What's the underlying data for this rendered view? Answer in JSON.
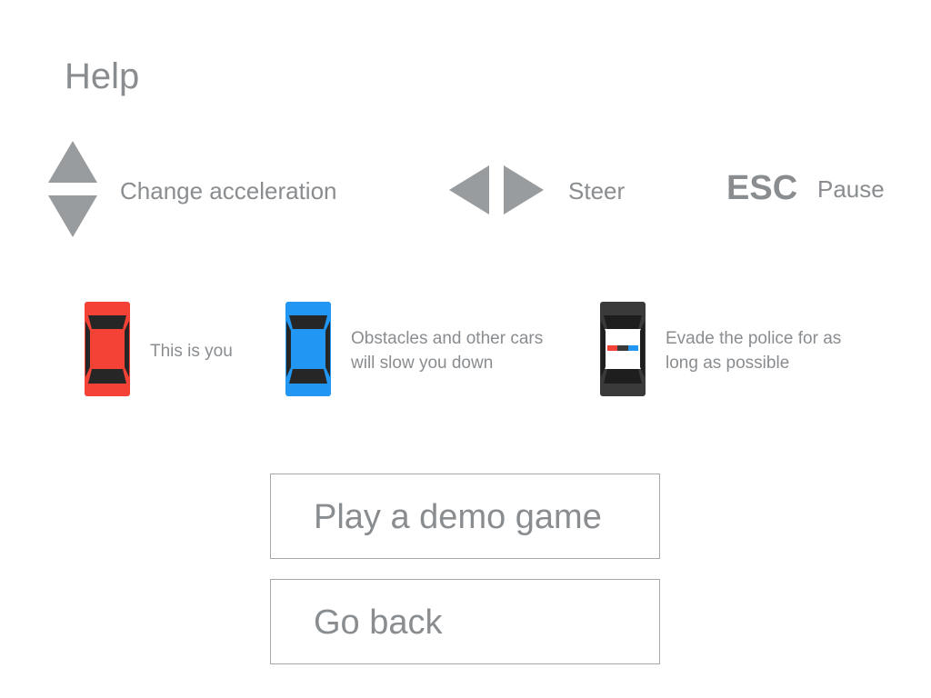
{
  "title": "Help",
  "controls": {
    "accel": {
      "icon": "up-down-arrows-icon",
      "label": "Change acceleration"
    },
    "steer": {
      "icon": "left-right-arrows-icon",
      "label": "Steer"
    },
    "pause": {
      "key": "ESC",
      "label": "Pause"
    }
  },
  "cars": {
    "player": {
      "icon": "red-car-icon",
      "color": "#f44336",
      "text": "This is you"
    },
    "obstacle": {
      "icon": "blue-car-icon",
      "color": "#2196f3",
      "line1": "Obstacles and other cars",
      "line2": "will slow you down"
    },
    "police": {
      "icon": "police-car-icon",
      "color": "#3a3a3a",
      "line1": "Evade the police for as",
      "line2": "long as possible"
    }
  },
  "buttons": {
    "demo": "Play a demo game",
    "back": "Go back"
  },
  "colors": {
    "text": "#8a8d90",
    "arrow": "#999c9f",
    "button_border": "#a8a8a8"
  }
}
